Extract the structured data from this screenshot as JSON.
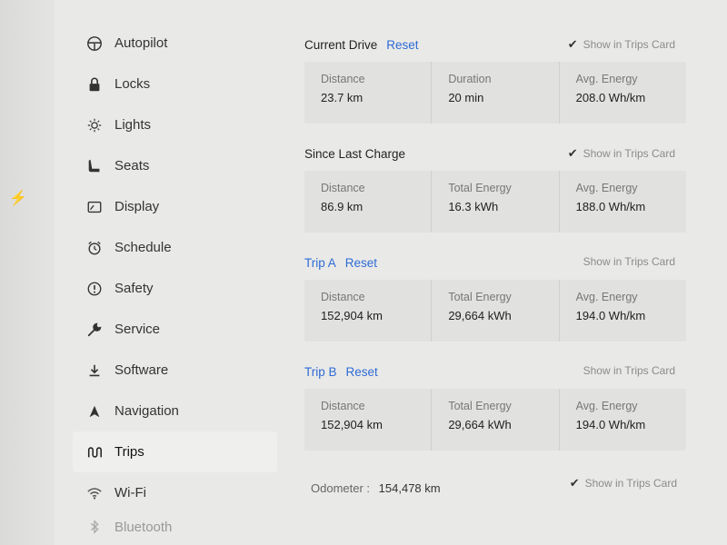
{
  "sidebar": {
    "items": [
      {
        "label": "Autopilot",
        "icon": "steering-wheel-icon"
      },
      {
        "label": "Locks",
        "icon": "lock-icon"
      },
      {
        "label": "Lights",
        "icon": "light-bulb-icon"
      },
      {
        "label": "Seats",
        "icon": "seat-icon"
      },
      {
        "label": "Display",
        "icon": "display-icon"
      },
      {
        "label": "Schedule",
        "icon": "clock-icon"
      },
      {
        "label": "Safety",
        "icon": "alert-circle-icon"
      },
      {
        "label": "Service",
        "icon": "wrench-icon"
      },
      {
        "label": "Software",
        "icon": "download-icon"
      },
      {
        "label": "Navigation",
        "icon": "navigation-arrow-icon"
      },
      {
        "label": "Trips",
        "icon": "trips-icon",
        "active": true
      },
      {
        "label": "Wi-Fi",
        "icon": "wifi-icon"
      },
      {
        "label": "Bluetooth",
        "icon": "bluetooth-icon",
        "faded": true
      }
    ]
  },
  "sections": {
    "current_drive": {
      "title": "Current Drive",
      "reset": "Reset",
      "show_card": "Show in Trips Card",
      "cells": [
        {
          "label": "Distance",
          "value": "23.7 km"
        },
        {
          "label": "Duration",
          "value": "20 min"
        },
        {
          "label": "Avg. Energy",
          "value": "208.0 Wh/km"
        }
      ]
    },
    "since_last_charge": {
      "title": "Since Last Charge",
      "show_card": "Show in Trips Card",
      "cells": [
        {
          "label": "Distance",
          "value": "86.9 km"
        },
        {
          "label": "Total Energy",
          "value": "16.3 kWh"
        },
        {
          "label": "Avg. Energy",
          "value": "188.0 Wh/km"
        }
      ]
    },
    "trip_a": {
      "title": "Trip A",
      "reset": "Reset",
      "show_card": "Show in Trips Card",
      "cells": [
        {
          "label": "Distance",
          "value": "152,904 km"
        },
        {
          "label": "Total Energy",
          "value": "29,664 kWh"
        },
        {
          "label": "Avg. Energy",
          "value": "194.0 Wh/km"
        }
      ]
    },
    "trip_b": {
      "title": "Trip B",
      "reset": "Reset",
      "show_card": "Show in Trips Card",
      "cells": [
        {
          "label": "Distance",
          "value": "152,904 km"
        },
        {
          "label": "Total Energy",
          "value": "29,664 kWh"
        },
        {
          "label": "Avg. Energy",
          "value": "194.0 Wh/km"
        }
      ]
    }
  },
  "odometer": {
    "label": "Odometer :",
    "value": "154,478 km",
    "show_card": "Show in Trips Card"
  },
  "colors": {
    "accent": "#2e6bd6",
    "background": "#e9e9e7"
  }
}
